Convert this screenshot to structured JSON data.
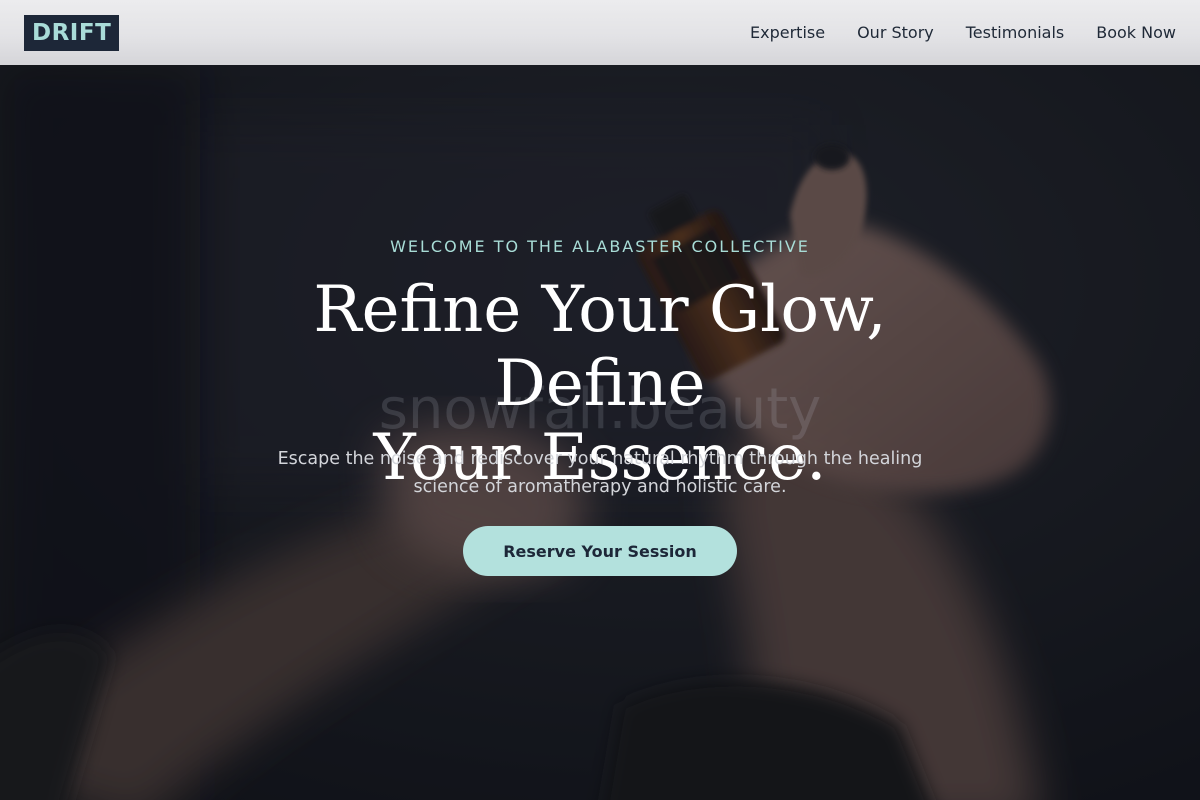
{
  "header": {
    "logo": "DRIFT",
    "nav": [
      {
        "label": "Expertise"
      },
      {
        "label": "Our Story"
      },
      {
        "label": "Testimonials"
      },
      {
        "label": "Book Now"
      }
    ]
  },
  "hero": {
    "eyebrow": "WELCOME TO THE ALABASTER COLLECTIVE",
    "headline_line1": "Refine Your Glow, Define",
    "headline_line2": "Your Essence.",
    "subtext_line1": "Escape the noise and rediscover your natural rhythm through the healing",
    "subtext_line2": "science of aromatherapy and holistic care.",
    "cta_label": "Reserve Your Session",
    "watermark": "snowfall.beauty"
  },
  "colors": {
    "accent": "#b3e1dd",
    "logo_bg": "#1d2738",
    "logo_text": "#a9dcd8",
    "eyebrow": "#a8dcd6",
    "header_bg": "#e6e6e9"
  },
  "icons": {
    "hero_image": "hands-holding-essential-oil-bottle-photo"
  }
}
